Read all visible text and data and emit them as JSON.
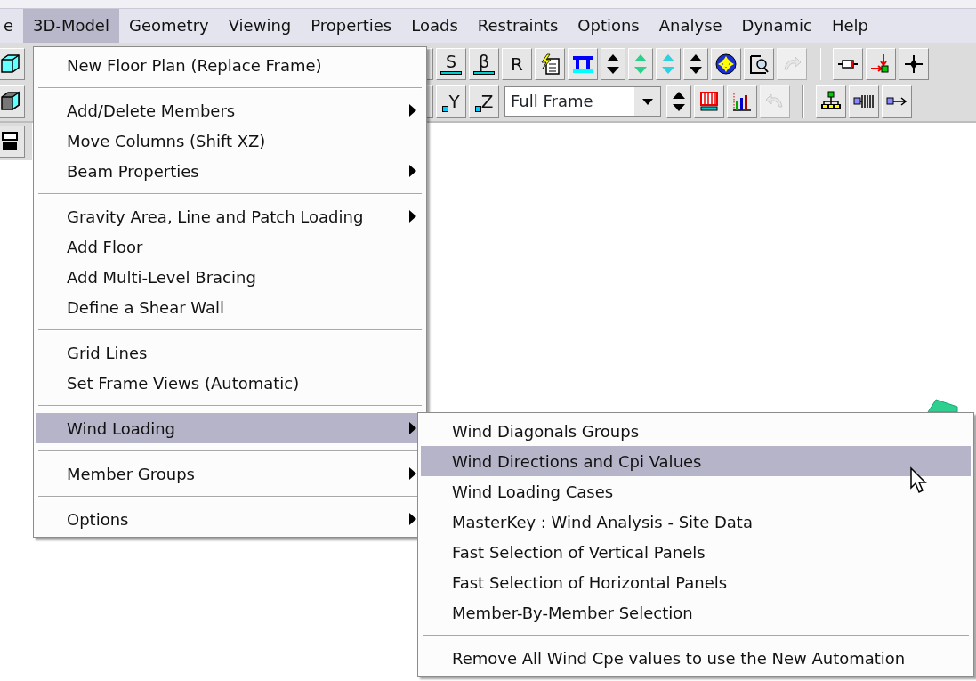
{
  "menu_bar": {
    "items": [
      {
        "label": "e",
        "selected": false
      },
      {
        "label": "3D-Model",
        "selected": true
      },
      {
        "label": "Geometry",
        "selected": false
      },
      {
        "label": "Viewing",
        "selected": false
      },
      {
        "label": "Properties",
        "selected": false
      },
      {
        "label": "Loads",
        "selected": false
      },
      {
        "label": "Restraints",
        "selected": false
      },
      {
        "label": "Options",
        "selected": false
      },
      {
        "label": "Analyse",
        "selected": false
      },
      {
        "label": "Dynamic",
        "selected": false
      },
      {
        "label": "Help",
        "selected": false
      }
    ]
  },
  "toolbar_rows": [
    {
      "left_button": {
        "kind": "cube",
        "disabled": false
      },
      "buttons": [
        {
          "kind": "edge",
          "disabled": false
        },
        {
          "kind": "letter",
          "label": "S",
          "disabled": false
        },
        {
          "kind": "letter",
          "label": "β",
          "disabled": false
        },
        {
          "kind": "plain",
          "label": "R",
          "disabled": false
        },
        {
          "kind": "lightning",
          "disabled": false
        },
        {
          "kind": "frame",
          "disabled": false
        },
        {
          "kind": "updown",
          "color": "#000000",
          "disabled": false
        },
        {
          "kind": "updown",
          "color": "#2bd18a",
          "disabled": false
        },
        {
          "kind": "updown",
          "color": "#2fd0e0",
          "disabled": false
        },
        {
          "kind": "updown",
          "color": "#000000",
          "disabled": false
        },
        {
          "kind": "compass",
          "disabled": false
        },
        {
          "kind": "preview",
          "disabled": false
        },
        {
          "kind": "redo",
          "disabled": true
        },
        {
          "kind": "separator"
        },
        {
          "kind": "resistor",
          "disabled": false
        },
        {
          "kind": "load",
          "disabled": false
        },
        {
          "kind": "node",
          "disabled": false
        }
      ]
    },
    {
      "left_button": {
        "kind": "cubegrey",
        "disabled": false
      },
      "buttons": [
        {
          "kind": "edge",
          "disabled": false
        },
        {
          "kind": "axis",
          "label": "Y",
          "disabled": false
        },
        {
          "kind": "axis",
          "label": "Z",
          "disabled": false
        },
        {
          "kind": "combo",
          "value": "Full Frame"
        },
        {
          "kind": "updown",
          "color": "#000000",
          "disabled": false
        },
        {
          "kind": "grid",
          "disabled": false
        },
        {
          "kind": "chart",
          "disabled": false
        },
        {
          "kind": "undo",
          "disabled": true
        },
        {
          "kind": "separator"
        },
        {
          "kind": "tree",
          "disabled": false
        },
        {
          "kind": "spring",
          "disabled": false
        },
        {
          "kind": "arrow",
          "disabled": false
        }
      ]
    },
    {
      "left_button": {
        "kind": "stack",
        "disabled": false
      },
      "buttons": []
    }
  ],
  "main_menu": {
    "items": [
      {
        "kind": "item",
        "label": "New Floor Plan (Replace Frame)",
        "submenu": false,
        "selected": false
      },
      {
        "kind": "separator"
      },
      {
        "kind": "item",
        "label": "Add/Delete Members",
        "submenu": true,
        "selected": false
      },
      {
        "kind": "item",
        "label": "Move Columns (Shift XZ)",
        "submenu": false,
        "selected": false
      },
      {
        "kind": "item",
        "label": "Beam Properties",
        "submenu": true,
        "selected": false
      },
      {
        "kind": "separator"
      },
      {
        "kind": "item",
        "label": "Gravity Area, Line and Patch Loading",
        "submenu": true,
        "selected": false
      },
      {
        "kind": "item",
        "label": "Add Floor",
        "submenu": false,
        "selected": false
      },
      {
        "kind": "item",
        "label": "Add Multi-Level Bracing",
        "submenu": false,
        "selected": false
      },
      {
        "kind": "item",
        "label": "Define a Shear Wall",
        "submenu": false,
        "selected": false
      },
      {
        "kind": "separator"
      },
      {
        "kind": "item",
        "label": "Grid Lines",
        "submenu": false,
        "selected": false
      },
      {
        "kind": "item",
        "label": "Set Frame Views (Automatic)",
        "submenu": false,
        "selected": false
      },
      {
        "kind": "separator"
      },
      {
        "kind": "item",
        "label": "Wind Loading",
        "submenu": true,
        "selected": true
      },
      {
        "kind": "separator"
      },
      {
        "kind": "item",
        "label": "Member Groups",
        "submenu": true,
        "selected": false
      },
      {
        "kind": "separator"
      },
      {
        "kind": "item",
        "label": "Options",
        "submenu": true,
        "selected": false
      }
    ]
  },
  "submenu": {
    "items": [
      {
        "kind": "item",
        "label": "Wind Diagonals Groups",
        "selected": false
      },
      {
        "kind": "item",
        "label": "Wind Directions and Cpi Values",
        "selected": true
      },
      {
        "kind": "item",
        "label": "Wind Loading Cases",
        "selected": false
      },
      {
        "kind": "item",
        "label": "MasterKey : Wind Analysis - Site Data",
        "selected": false
      },
      {
        "kind": "item",
        "label": "Fast Selection of Vertical Panels",
        "selected": false
      },
      {
        "kind": "item",
        "label": "Fast Selection of Horizontal Panels",
        "selected": false
      },
      {
        "kind": "item",
        "label": "Member-By-Member Selection",
        "selected": false
      },
      {
        "kind": "separator"
      },
      {
        "kind": "item",
        "label": "Remove All Wind Cpe values to use the New Automation",
        "selected": false
      }
    ]
  }
}
